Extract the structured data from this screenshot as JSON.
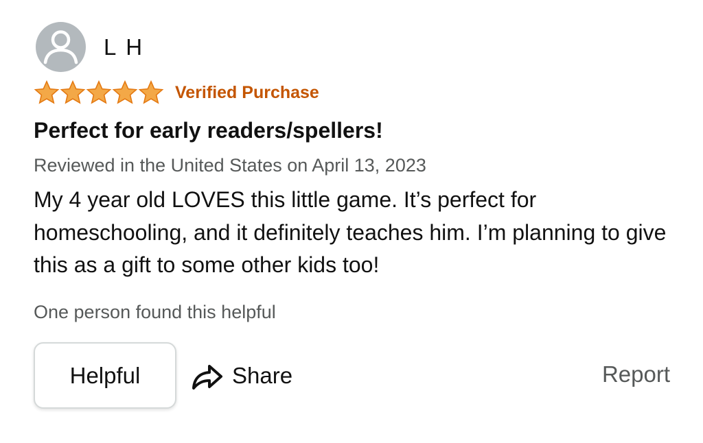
{
  "reviewer": {
    "name": "L H",
    "avatar_icon": "user-avatar-icon"
  },
  "rating": {
    "stars": 5,
    "max": 5,
    "star_color": "#f3a847",
    "star_stroke": "#e47911",
    "verified_label": "Verified Purchase",
    "verified_color": "#c45500"
  },
  "review": {
    "title": "Perfect for early readers/spellers!",
    "meta": "Reviewed in the United States on April 13, 2023",
    "body": "My 4 year old LOVES this little game. It’s perfect for homeschooling, and it definitely teaches him. I’m planning to give this as a gift to some other kids too!",
    "helpful_count_text": "One person found this helpful"
  },
  "actions": {
    "helpful_label": "Helpful",
    "share_label": "Share",
    "share_icon": "share-arrow-icon",
    "report_label": "Report"
  }
}
